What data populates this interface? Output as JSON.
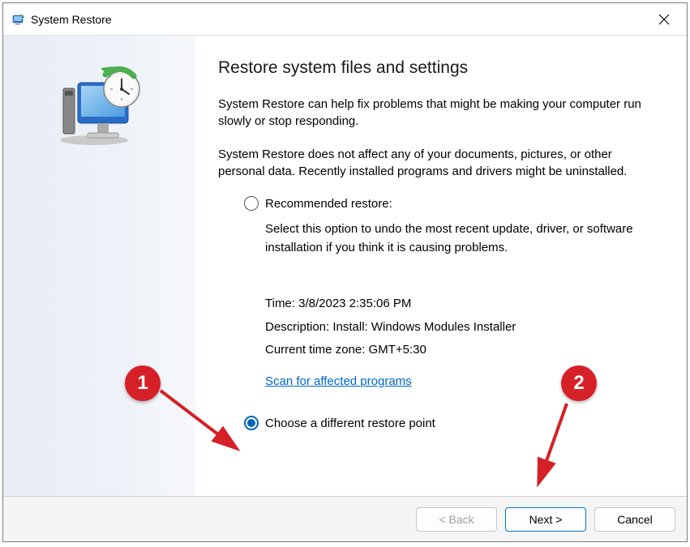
{
  "titlebar": {
    "title": "System Restore"
  },
  "content": {
    "heading": "Restore system files and settings",
    "p1": "System Restore can help fix problems that might be making your computer run slowly or stop responding.",
    "p2": "System Restore does not affect any of your documents, pictures, or other personal data. Recently installed programs and drivers might be uninstalled.",
    "options": {
      "recommended": {
        "label": "Recommended restore:",
        "desc": "Select this option to undo the most recent update, driver, or software installation if you think it is causing problems.",
        "time": "Time: 3/8/2023 2:35:06 PM",
        "description": "Description: Install: Windows Modules Installer",
        "tz": "Current time zone: GMT+5:30",
        "scan_link": "Scan for affected programs"
      },
      "choose": {
        "label": "Choose a different restore point"
      }
    }
  },
  "footer": {
    "back": "< Back",
    "next": "Next >",
    "cancel": "Cancel"
  },
  "annotations": {
    "n1": "1",
    "n2": "2"
  }
}
